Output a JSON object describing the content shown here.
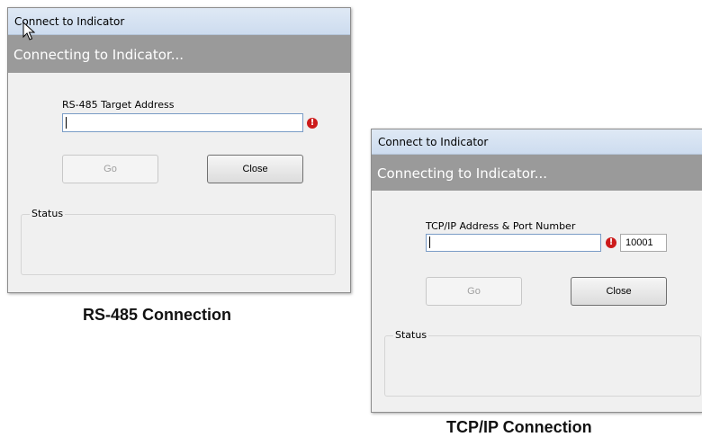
{
  "rs485_dialog": {
    "title": "Connect to Indicator",
    "banner": "Connecting to Indicator...",
    "field_label": "RS-485 Target Address",
    "address_value": "",
    "go_label": "Go",
    "close_label": "Close",
    "status_label": "Status",
    "caption": "RS-485 Connection"
  },
  "tcpip_dialog": {
    "title": "Connect to Indicator",
    "banner": "Connecting to Indicator...",
    "field_label": "TCP/IP Address & Port Number",
    "address_value": "",
    "port_value": "10001",
    "go_label": "Go",
    "close_label": "Close",
    "status_label": "Status",
    "caption": "TCP/IP Connection"
  },
  "colors": {
    "banner": "#9a9a9a",
    "error": "#cc1a1a",
    "window_bg": "#f0f0f0"
  },
  "icons": {
    "error": "exclamation-circle-icon",
    "cursor": "mouse-pointer-icon"
  }
}
